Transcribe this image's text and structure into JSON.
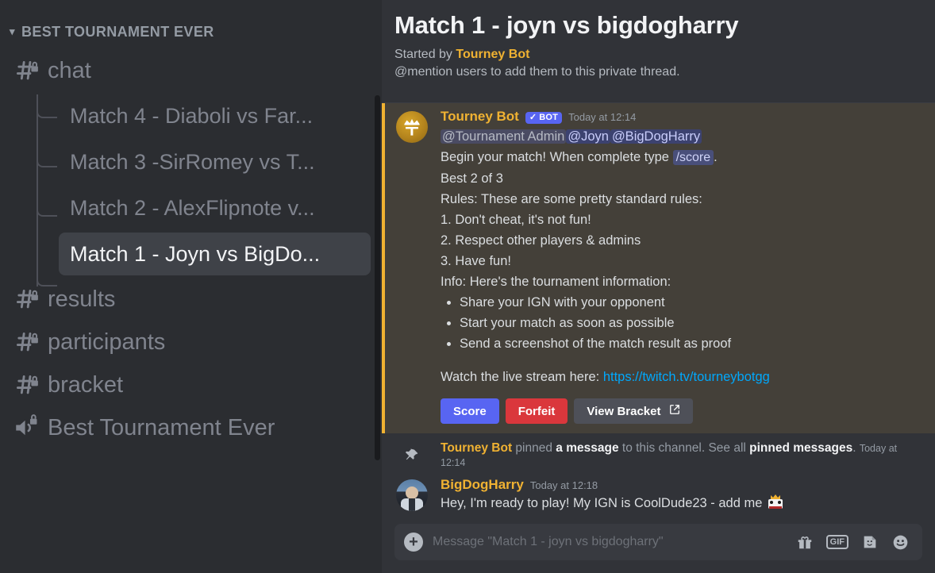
{
  "sidebar": {
    "category": {
      "label": "Best Tournament Ever",
      "chevron": "chevron-down-icon"
    },
    "channels": [
      {
        "name": "chat",
        "icon": "hash-locked-icon",
        "type": "text-private"
      },
      {
        "name": "results",
        "icon": "hash-locked-icon",
        "type": "text-private"
      },
      {
        "name": "participants",
        "icon": "hash-locked-icon",
        "type": "text-private"
      },
      {
        "name": "bracket",
        "icon": "hash-locked-icon",
        "type": "text-private"
      },
      {
        "name": "Best Tournament Ever",
        "icon": "speaker-locked-icon",
        "type": "voice-private"
      }
    ],
    "threads": [
      {
        "label": "Match 4 - Diaboli vs Far...",
        "active": false
      },
      {
        "label": "Match 3 -SirRomey vs T...",
        "active": false
      },
      {
        "label": "Match 2 - AlexFlipnote v...",
        "active": false
      },
      {
        "label": "Match 1 - Joyn vs BigDo...",
        "active": true
      }
    ]
  },
  "header": {
    "title": "Match 1 - joyn vs bigdogharry",
    "started_prefix": "Started by",
    "started_by": "Tourney Bot",
    "subtitle": "@mention users to add them to this private thread."
  },
  "messages": {
    "bot": {
      "author": "Tourney Bot",
      "badge": "BOT",
      "badge_check": "✓",
      "timestamp": "Today at 12:14",
      "avatar": "tourney-bot-crown-avatar",
      "mentions": [
        {
          "text": "@Tournament Admin",
          "kind": "role"
        },
        {
          "text": "@Joyn",
          "kind": "user"
        },
        {
          "text": "@BigDogHarry",
          "kind": "user"
        }
      ],
      "line_begin_pre": "Begin your match! When complete type ",
      "line_begin_code": "/score",
      "line_begin_post": ".",
      "line_best_of": "Best 2 of 3",
      "rules_heading": "Rules: These are some pretty standard rules:",
      "rules": [
        "1. Don't cheat, it's not fun!",
        "2. Respect other players & admins",
        "3. Have fun!"
      ],
      "info_heading": "Info: Here's the tournament information:",
      "info_bullets": [
        "Share your IGN with your opponent",
        "Start your match as soon as possible",
        "Send a screenshot of the match result as proof"
      ],
      "stream_prefix": "Watch the live stream here: ",
      "stream_link": "https://twitch.tv/tourneybotgg",
      "buttons": [
        {
          "label": "Score",
          "style": "primary"
        },
        {
          "label": "Forfeit",
          "style": "danger"
        },
        {
          "label": "View Bracket",
          "style": "secondary",
          "icon": "external-link-icon"
        }
      ]
    },
    "pin_system": {
      "icon": "pin-icon",
      "actor": "Tourney Bot",
      "verb": " pinned ",
      "object": "a message",
      "mid": " to this channel. See all ",
      "link": "pinned messages",
      "period": ".",
      "timestamp": "Today at 12:14"
    },
    "user": {
      "author": "BigDogHarry",
      "timestamp": "Today at 12:18",
      "avatar": "bigdogharry-photo-avatar",
      "text": "Hey, I'm ready to play! My IGN is CoolDude23 - add me",
      "emoji": "crown-face-emoji"
    }
  },
  "composer": {
    "plus_icon": "add-attachment-icon",
    "placeholder": "Message \"Match 1 - joyn vs bigdogharry\"",
    "value": "",
    "icons": [
      {
        "name": "gift-icon",
        "label": ""
      },
      {
        "name": "gif-icon",
        "label": "GIF"
      },
      {
        "name": "sticker-icon",
        "label": ""
      },
      {
        "name": "emoji-icon",
        "label": ""
      }
    ]
  },
  "colors": {
    "accent": "#5865f2",
    "danger": "#da373c",
    "mention_bar": "#f0b232",
    "mention_bg": "#444039",
    "link": "#00a8fc",
    "sidebar_bg": "#2b2d31",
    "main_bg": "#313338"
  }
}
